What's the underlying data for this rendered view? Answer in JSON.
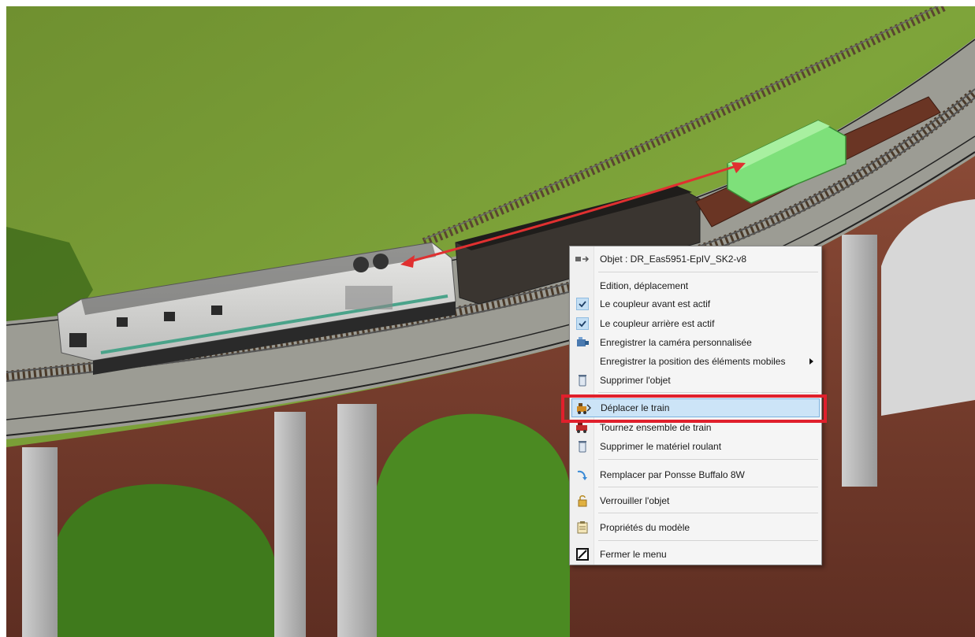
{
  "context_menu": {
    "object_label": "Objet : DR_Eas5951-EpIV_SK2-v8",
    "items": [
      {
        "label": "Edition, déplacement",
        "icon": "none"
      },
      {
        "label": "Le coupleur avant est actif",
        "icon": "checkmark-icon",
        "checked": true
      },
      {
        "label": "Le coupleur arrière est actif",
        "icon": "checkmark-icon",
        "checked": true
      },
      {
        "label": "Enregistrer la caméra personnalisée",
        "icon": "camera-save-icon"
      },
      {
        "label": "Enregistrer la position des éléments mobiles",
        "icon": "none",
        "has_submenu": true
      },
      {
        "label": "Supprimer l'objet",
        "icon": "trash-icon"
      },
      {
        "label": "Déplacer le train",
        "icon": "move-train-icon",
        "highlighted": true
      },
      {
        "label": "Tournez ensemble de train",
        "icon": "turn-train-icon"
      },
      {
        "label": "Supprimer le matériel roulant",
        "icon": "trash-icon"
      },
      {
        "label": "Remplacer par Ponsse Buffalo 8W",
        "icon": "replace-arrow-icon"
      },
      {
        "label": "Verrouiller l'objet",
        "icon": "lock-icon"
      },
      {
        "label": "Propriétés du modèle",
        "icon": "clipboard-icon"
      },
      {
        "label": "Fermer le menu",
        "icon": "close-menu-icon"
      }
    ]
  },
  "colors": {
    "highlight_frame": "#e0202c",
    "menu_hover": "#cce4f7",
    "grass": "#6f9a2c",
    "brick": "#7a4030",
    "selected_wagon": "#7ee07a"
  }
}
